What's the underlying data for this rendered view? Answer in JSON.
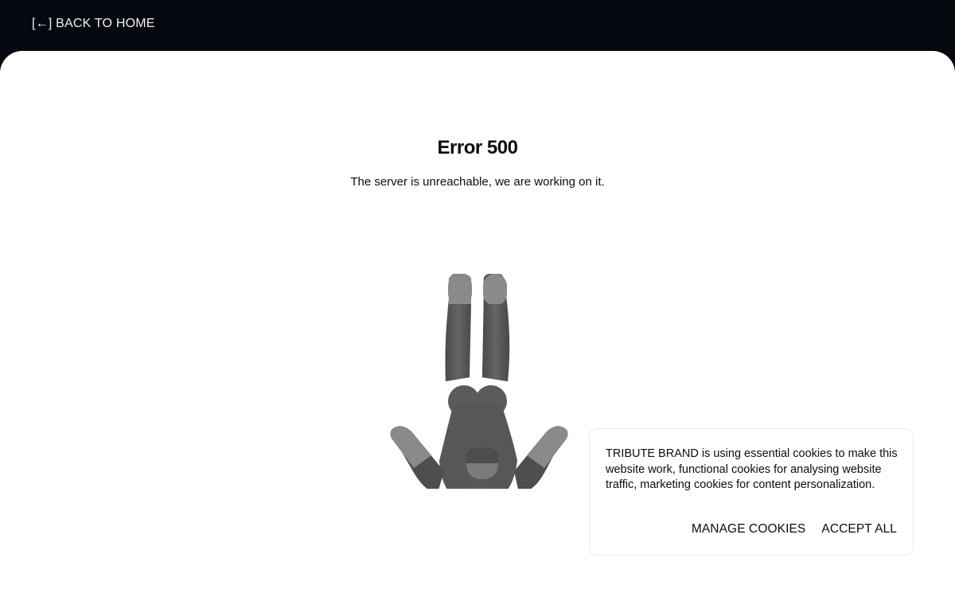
{
  "header": {
    "back_link_label": "[←] BACK TO HOME"
  },
  "error": {
    "title": "Error 500",
    "message": "The server is unreachable, we are working on it."
  },
  "illustration": {
    "icon": "upside-down-figure-icon"
  },
  "cookie_banner": {
    "text": "TRIBUTE BRAND is using essential cookies to make this website work, functional cookies for analysing website traffic, marketing cookies for content personalization.",
    "manage_label": "MANAGE COOKIES",
    "accept_label": "ACCEPT ALL"
  },
  "colors": {
    "header_bg": "#05080f",
    "content_bg": "#ffffff",
    "text": "#0b0d12",
    "figure_dark": "#555555",
    "figure_light": "#8a8a8a"
  }
}
